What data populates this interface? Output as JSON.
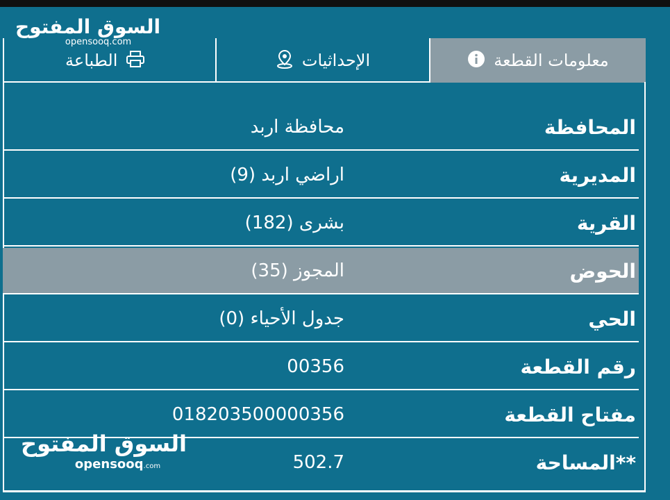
{
  "tabs": {
    "info": {
      "label": "معلومات القطعة",
      "icon": "info-icon"
    },
    "coords": {
      "label": "الإحداثيات",
      "icon": "map-pin-icon"
    },
    "print": {
      "label": "الطباعة",
      "icon": "printer-icon"
    }
  },
  "rows": [
    {
      "key": "المحافظة",
      "value": "محافظة اربد"
    },
    {
      "key": "المديرية",
      "value": "اراضي اربد (9)"
    },
    {
      "key": "القرية",
      "value": "بشرى (182)"
    },
    {
      "key": "الحوض",
      "value": "المجوز (35)",
      "highlighted": true
    },
    {
      "key": "الحي",
      "value": "جدول الأحياء (0)"
    },
    {
      "key": "رقم القطعة",
      "value": "00356"
    },
    {
      "key": "مفتاح القطعة",
      "value": "018203500000356"
    },
    {
      "key": "**المساحة",
      "value": "502.7"
    }
  ],
  "watermark": {
    "arabic": "السوق المفتوح",
    "english": "opensooq",
    "domain": ".com"
  },
  "colors": {
    "background": "#0f6f8e",
    "active_tab": "#8b9ca5",
    "highlight_row": "#8b9ca5",
    "text": "#ffffff"
  }
}
